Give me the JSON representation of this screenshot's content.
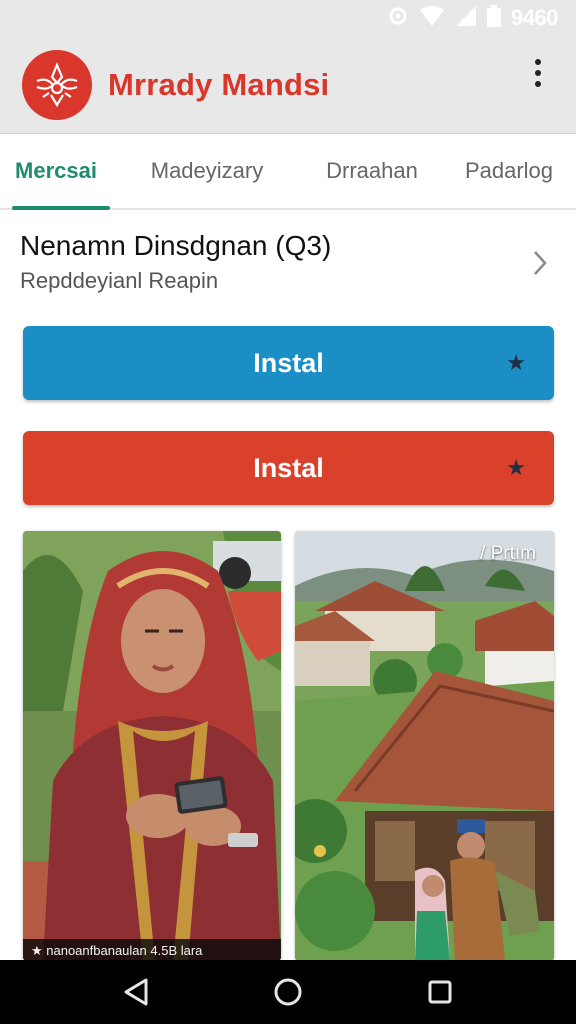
{
  "status_bar": {
    "time": "9460",
    "icons": [
      "gear-icon",
      "wifi-icon",
      "signal-icon",
      "battery-icon"
    ]
  },
  "app_bar": {
    "title": "Mrrady Mandsi",
    "logo_icon": "ornament-logo-icon",
    "menu_icon": "more-vert-icon"
  },
  "tabs": [
    {
      "label": "Mercsai",
      "active": true
    },
    {
      "label": "Madeyizary",
      "active": false
    },
    {
      "label": "Drraahan",
      "active": false
    },
    {
      "label": "Padarlog",
      "active": false
    }
  ],
  "section": {
    "title": "Nenamn Dinsdgnan (Q3)",
    "subtitle": "Repddeyianl Reapin",
    "chevron_icon": "chevron-right-icon"
  },
  "buttons": {
    "install_primary": {
      "label": "Instal",
      "color": "#1b8ec6",
      "icon": "star-icon"
    },
    "install_secondary": {
      "label": "Instal",
      "color": "#d9412a",
      "icon": "star-icon"
    }
  },
  "cards": [
    {
      "caption": "★ nanoanfbanaulan 4.5B lara",
      "image": "woman-in-headscarf-using-phone"
    },
    {
      "tag": "/ Prtım",
      "image": "traditional-village-houses-with-couple"
    }
  ],
  "nav": {
    "back_icon": "back-triangle-icon",
    "home_icon": "home-circle-icon",
    "recents_icon": "recents-square-icon"
  },
  "colors": {
    "brand": "#d9372b",
    "tab_active": "#1f8c6f",
    "install_blue": "#1b8ec6",
    "install_red": "#d9412a"
  }
}
